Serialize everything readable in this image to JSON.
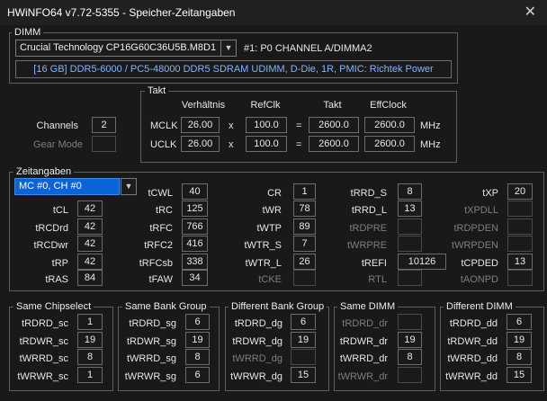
{
  "window": {
    "title": "HWiNFO64 v7.72-5355 - Speicher-Zeitangaben",
    "close": "✕"
  },
  "dimm": {
    "group_label": "DIMM",
    "module": "Crucial Technology CP16G60C36U5B.M8D1",
    "slot": "#1: P0 CHANNEL A/DIMMA2",
    "info": "[16 GB] DDR5-6000 / PC5-48000 DDR5 SDRAM UDIMM, D-Die, 1R, PMIC: Richtek Power"
  },
  "channels": {
    "label": "Channels",
    "value": "2",
    "gear_label": "Gear Mode",
    "gear_value": ""
  },
  "takt": {
    "group_label": "Takt",
    "headers": {
      "ratio": "Verhältnis",
      "refclk": "RefClk",
      "takt": "Takt",
      "eff": "EffClock"
    },
    "mclk": {
      "label": "MCLK",
      "ratio": "26.00",
      "x1": "x",
      "refclk": "100.0",
      "eq": "=",
      "takt": "2600.0",
      "eff": "2600.0",
      "unit": "MHz"
    },
    "uclk": {
      "label": "UCLK",
      "ratio": "26.00",
      "x1": "x",
      "refclk": "100.0",
      "eq": "=",
      "takt": "2600.0",
      "eff": "2600.0",
      "unit": "MHz"
    }
  },
  "zeit": {
    "group_label": "Zeitangaben",
    "controller": "MC #0, CH #0",
    "tCWL": {
      "l": "tCWL",
      "v": "40"
    },
    "tCL": {
      "l": "tCL",
      "v": "42"
    },
    "tRC": {
      "l": "tRC",
      "v": "125"
    },
    "tRCDrd": {
      "l": "tRCDrd",
      "v": "42"
    },
    "tRFC": {
      "l": "tRFC",
      "v": "766"
    },
    "tRCDwr": {
      "l": "tRCDwr",
      "v": "42"
    },
    "tRFC2": {
      "l": "tRFC2",
      "v": "416"
    },
    "tRP": {
      "l": "tRP",
      "v": "42"
    },
    "tRFCsb": {
      "l": "tRFCsb",
      "v": "338"
    },
    "tRAS": {
      "l": "tRAS",
      "v": "84"
    },
    "tFAW": {
      "l": "tFAW",
      "v": "34"
    },
    "CR": {
      "l": "CR",
      "v": "1"
    },
    "tWR": {
      "l": "tWR",
      "v": "78"
    },
    "tWTP": {
      "l": "tWTP",
      "v": "89"
    },
    "tWTR_S": {
      "l": "tWTR_S",
      "v": "7"
    },
    "tWTR_L": {
      "l": "tWTR_L",
      "v": "26"
    },
    "tCKE": {
      "l": "tCKE",
      "v": ""
    },
    "tRRD_S": {
      "l": "tRRD_S",
      "v": "8"
    },
    "tRRD_L": {
      "l": "tRRD_L",
      "v": "13"
    },
    "tRDPRE": {
      "l": "tRDPRE",
      "v": ""
    },
    "tWRPRE": {
      "l": "tWRPRE",
      "v": ""
    },
    "tREFI": {
      "l": "tREFI",
      "v": "10126"
    },
    "RTL": {
      "l": "RTL",
      "v": ""
    },
    "tXP": {
      "l": "tXP",
      "v": "20"
    },
    "tXPDLL": {
      "l": "tXPDLL",
      "v": ""
    },
    "tRPDEN": {
      "l": "tRDPDEN",
      "v": ""
    },
    "tWRPDEN": {
      "l": "tWRPDEN",
      "v": ""
    },
    "tCPDED": {
      "l": "tCPDED",
      "v": "13"
    },
    "tAONPD": {
      "l": "tAONPD",
      "v": ""
    }
  },
  "groups": {
    "sc": {
      "label": "Same Chipselect",
      "rows": [
        {
          "l": "tRDRD_sc",
          "v": "1"
        },
        {
          "l": "tRDWR_sc",
          "v": "19"
        },
        {
          "l": "tWRRD_sc",
          "v": "8"
        },
        {
          "l": "tWRWR_sc",
          "v": "1"
        }
      ]
    },
    "sg": {
      "label": "Same Bank Group",
      "rows": [
        {
          "l": "tRDRD_sg",
          "v": "6"
        },
        {
          "l": "tRDWR_sg",
          "v": "19"
        },
        {
          "l": "tWRRD_sg",
          "v": "8"
        },
        {
          "l": "tWRWR_sg",
          "v": "6"
        }
      ]
    },
    "dg": {
      "label": "Different Bank Group",
      "rows": [
        {
          "l": "tRDRD_dg",
          "v": "6"
        },
        {
          "l": "tRDWR_dg",
          "v": "19"
        },
        {
          "l": "tWRRD_dg",
          "v": ""
        },
        {
          "l": "tWRWR_dg",
          "v": "15"
        }
      ]
    },
    "dr": {
      "label": "Same DIMM",
      "rows": [
        {
          "l": "tRDRD_dr",
          "v": ""
        },
        {
          "l": "tRDWR_dr",
          "v": "19"
        },
        {
          "l": "tWRRD_dr",
          "v": "8"
        },
        {
          "l": "tWRWR_dr",
          "v": ""
        }
      ]
    },
    "dd": {
      "label": "Different DIMM",
      "rows": [
        {
          "l": "tRDRD_dd",
          "v": "6"
        },
        {
          "l": "tRDWR_dd",
          "v": "19"
        },
        {
          "l": "tWRRD_dd",
          "v": "8"
        },
        {
          "l": "tWRWR_dd",
          "v": "15"
        }
      ]
    }
  }
}
